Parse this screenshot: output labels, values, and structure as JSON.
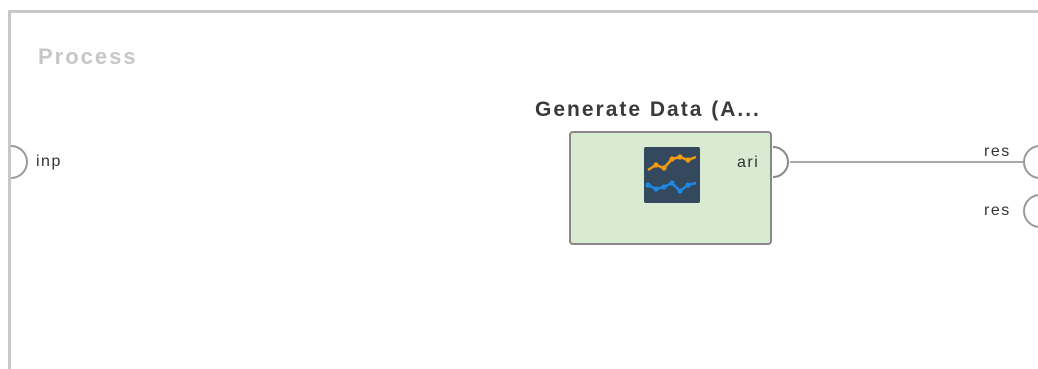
{
  "process": {
    "title": "Process"
  },
  "input_port": {
    "label": "inp"
  },
  "operator": {
    "title": "Generate Data (A...",
    "output_port_label": "ari",
    "icon": "line-chart-icon",
    "colors": {
      "background": "#d9ead3",
      "border": "#888888",
      "icon_bg": "#34495e",
      "series_orange": "#f39c12",
      "series_blue": "#1e88e5"
    }
  },
  "result_ports": [
    {
      "label": "res"
    },
    {
      "label": "res"
    }
  ],
  "colors": {
    "frame": "#c8c8c8",
    "process_title": "#c7c7c7",
    "connection": "#aaaaaa",
    "port_stroke": "#999999"
  }
}
